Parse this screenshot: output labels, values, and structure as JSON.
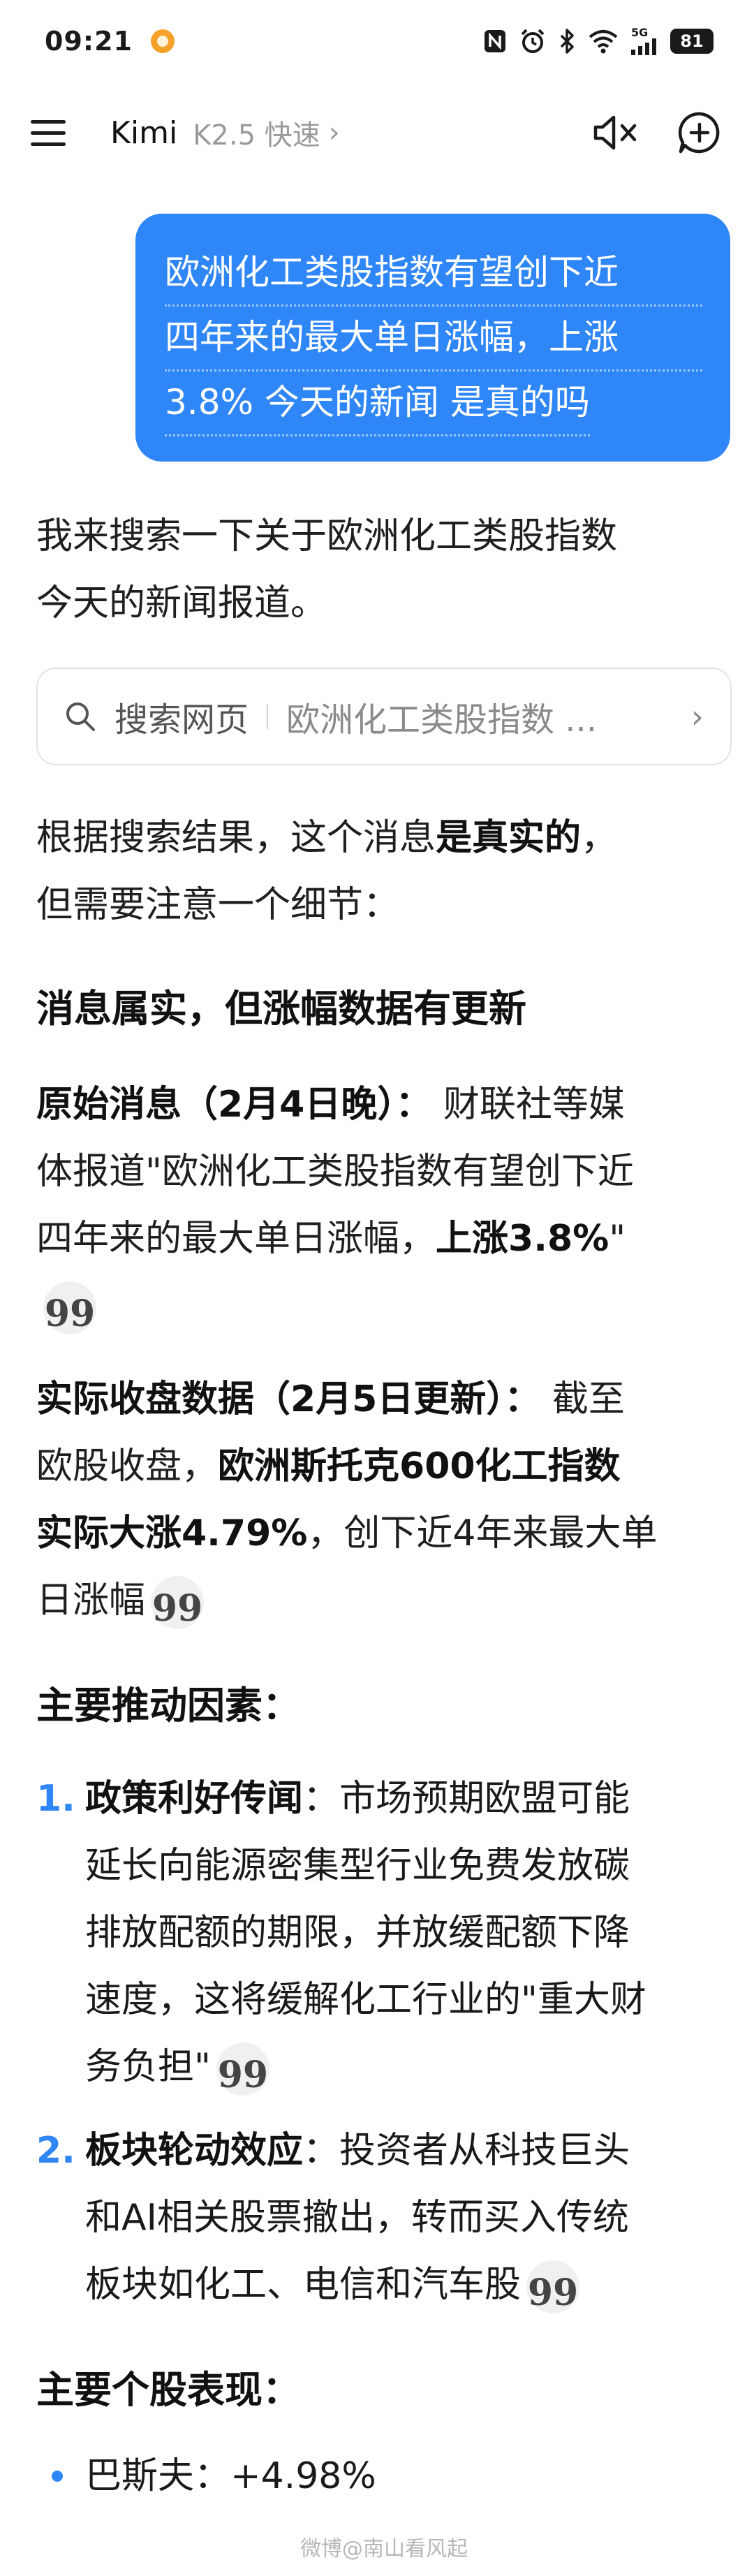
{
  "status_bar": {
    "time": "09:21",
    "network_label": "5G",
    "battery": "81"
  },
  "header": {
    "app_name": "Kimi",
    "model": "K2.5 快速"
  },
  "user_message": {
    "lines": [
      "欧洲化工类股指数有望创下近",
      "四年来的最大单日涨幅，上涨",
      "3.8% 今天的新闻 是真的吗"
    ]
  },
  "assistant": {
    "intro_lines": [
      "我来搜索一下关于欧洲化工类股指数",
      "今天的新闻报道。"
    ],
    "search_card": {
      "label": "搜索网页",
      "query": "欧洲化工类股指数 ..."
    },
    "result_a": "根据搜索结果，这个消息",
    "result_bold": "是真实的",
    "result_b": "，",
    "result_line2": "但需要注意一个细节：",
    "heading1": "消息属实，但涨幅数据有更新",
    "original": {
      "label": "原始消息（2月4日晚）：",
      "line1_tail": " 财联社等媒",
      "line2": "体报道\"欧洲化工类股指数有望创下近",
      "line3_a": "四年来的最大单日涨幅，",
      "line3_bold": "上涨3.8%",
      "line3_b": "\""
    },
    "actual": {
      "label": "实际收盘数据（2月5日更新）：",
      "line1_tail": " 截至",
      "line2_a": "欧股收盘，",
      "line2_bold": "欧洲斯托克600化工指数",
      "line3_bold": "实际大涨4.79%",
      "line3_b": "，创下近4年来最大单",
      "line4": "日涨幅"
    },
    "heading2": "主要推动因素：",
    "drivers": [
      {
        "num": "1.",
        "title": "政策利好传闻",
        "lines": [
          "：市场预期欧盟可能",
          "延长向能源密集型行业免费发放碳",
          "排放配额的期限，并放缓配额下降",
          "速度，这将缓解化工行业的\"重大财",
          "务负担\""
        ]
      },
      {
        "num": "2.",
        "title": "板块轮动效应",
        "lines": [
          "：投资者从科技巨头",
          "和AI相关股票撤出，转而买入传统",
          "板块如化工、电信和汽车股"
        ]
      }
    ],
    "heading3": "主要个股表现：",
    "stocks": [
      {
        "name": "巴斯夫：",
        "value": "+4.98%"
      }
    ]
  },
  "cite_glyph": "99",
  "watermark": "微博@南山看风起"
}
